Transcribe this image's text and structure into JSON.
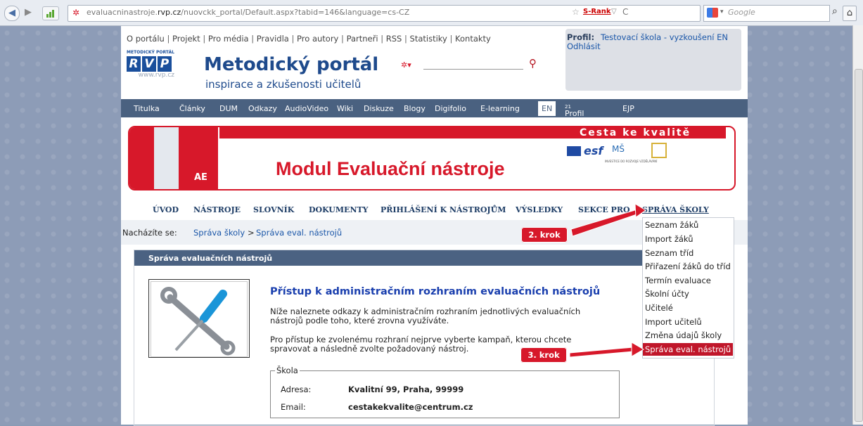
{
  "browser": {
    "url_prefix": "evaluacninastroje.",
    "url_domain": "rvp.cz",
    "url_path": "/nuovckk_portal/Default.aspx?tabid=146&language=cs-CZ",
    "rank_label": "S-Rank",
    "search_placeholder": "Google"
  },
  "header": {
    "top_links": [
      "O portálu",
      "Projekt",
      "Pro média",
      "Pravidla",
      "Pro autory",
      "Partneři",
      "RSS",
      "Statistiky",
      "Kontakty"
    ],
    "separator": "|",
    "logo_small": "METODICKÝ PORTÁL",
    "logo_letters": [
      "R",
      "V",
      "P"
    ],
    "logo_url": "www.rvp.cz",
    "site_title": "Metodický portál",
    "site_subtitle": "inspirace a zkušenosti učitelů",
    "profile_label": "Profil:",
    "profile_value": "Testovací škola - vyzkoušení EN",
    "logout": "Odhlásit"
  },
  "menu": [
    "Titulka",
    "Články",
    "DUM",
    "Odkazy",
    "AudioVideo",
    "Wiki",
    "Diskuze",
    "Blogy",
    "Digifolio",
    "E-learning",
    "EN",
    "Profil Škola",
    "EJP"
  ],
  "menu_sup": "21",
  "banner": {
    "slogan": "Cesta ke kvalitě",
    "logo_text": "AE",
    "title": "Modul Evaluační nástroje",
    "caption": "INVESTICE DO ROZVOJE VZDĚLÁVÁNÍ"
  },
  "subnav": [
    "ÚVOD",
    "NÁSTROJE",
    "SLOVNÍK",
    "DOKUMENTY",
    "PŘIHLÁŠENÍ K NÁSTROJŮM",
    "VÝSLEDKY",
    "SEKCE PRO",
    "SPRÁVA ŠKOLY"
  ],
  "breadcrumb": {
    "label": "Nacházíte se:",
    "item1": "Správa školy",
    "sep": ">",
    "item2": "Správa eval. nástrojů"
  },
  "panel": {
    "title": "Správa evaluačních nástrojů",
    "heading": "Přístup k administračním rozhraním evaluačních nástrojů",
    "para1": "Níže naleznete odkazy k administračním rozhraním jednotlivých evaluačních nástrojů podle toho, které zrovna využíváte.",
    "para2": "Pro přístup ke zvolenému rozhraní nejprve vyberte kampaň, kterou chcete spravovat a následně zvolte požadovaný nástroj.",
    "school_legend": "Škola",
    "address_label": "Adresa:",
    "address_value": "Kvalitní 99, Praha, 99999",
    "email_label": "Email:",
    "email_value": "cestakekvalite@centrum.cz"
  },
  "dropdown": [
    "Seznam žáků",
    "Import žáků",
    "Seznam tříd",
    "Přiřazení žáků do tříd",
    "Termín evaluace",
    "Školní účty",
    "Učitelé",
    "Import učitelů",
    "Změna údajů školy",
    "Správa eval. nástrojů"
  ],
  "callouts": {
    "step2": "2. krok",
    "step3": "3. krok"
  },
  "colors": {
    "accent_red": "#d7182a",
    "menu_bg": "#4a6180",
    "link_blue": "#1a56a8",
    "nav_text": "#1e3d66"
  }
}
